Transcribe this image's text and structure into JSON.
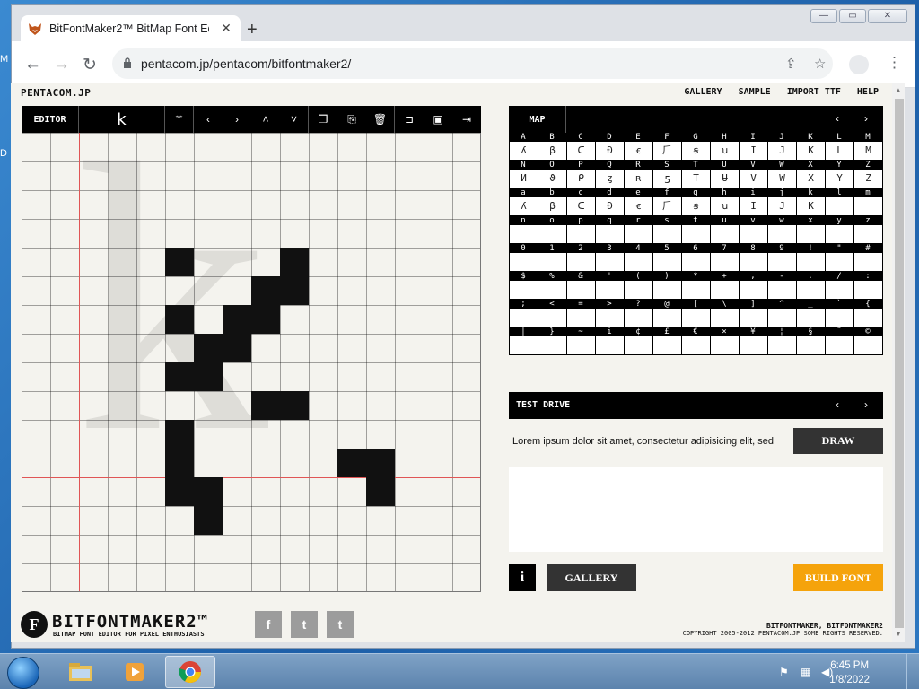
{
  "desktop": {
    "edge_labels": [
      "M",
      "D"
    ]
  },
  "browser": {
    "tab_title": "BitFontMaker2™ BitMap Font Edi",
    "url": "pentacom.jp/pentacom/bitfontmaker2/"
  },
  "page": {
    "brand": "PENTACOM.JP",
    "nav": [
      "GALLERY",
      "SAMPLE",
      "IMPORT TTF",
      "HELP"
    ],
    "editor": {
      "label": "EDITOR",
      "current_char": "k",
      "tools": [
        "magic-wand-icon",
        "arrow-left-icon",
        "arrow-right-icon",
        "arrow-up-icon",
        "arrow-down-icon",
        "copy-icon",
        "paste-icon",
        "trash-icon",
        "open-icon",
        "save-icon",
        "export-icon"
      ]
    },
    "map": {
      "title": "MAP",
      "rows": [
        {
          "header": [
            "A",
            "B",
            "C",
            "D",
            "E",
            "F",
            "G",
            "H",
            "I",
            "J",
            "K",
            "L",
            "M"
          ],
          "glyphs": [
            "ʎ",
            "β",
            "ᑕ",
            "Ð",
            "ꞓ",
            "⺁",
            "ꞩ",
            "ꭒ",
            "I",
            "J",
            "K",
            "L",
            "M"
          ]
        },
        {
          "header": [
            "N",
            "O",
            "P",
            "Q",
            "R",
            "S",
            "T",
            "U",
            "V",
            "W",
            "X",
            "Y",
            "Z"
          ],
          "glyphs": [
            "И",
            "ϑ",
            "ᑭ",
            "ȥ",
            "ʀ",
            "ƽ",
            "T",
            "Ʉ",
            "V",
            "W",
            "X",
            "Y",
            "Z"
          ]
        },
        {
          "header": [
            "a",
            "b",
            "c",
            "d",
            "e",
            "f",
            "g",
            "h",
            "i",
            "j",
            "k",
            "l",
            "m"
          ],
          "glyphs": [
            "ʎ",
            "β",
            "ᑕ",
            "Ð",
            "ꞓ",
            "⺁",
            "ꞩ",
            "ꭒ",
            "I",
            "J",
            "K",
            "",
            ""
          ]
        },
        {
          "header": [
            "n",
            "o",
            "p",
            "q",
            "r",
            "s",
            "t",
            "u",
            "v",
            "w",
            "x",
            "y",
            "z"
          ],
          "glyphs": [
            "",
            "",
            "",
            "",
            "",
            "",
            "",
            "",
            "",
            "",
            "",
            "",
            ""
          ]
        },
        {
          "header": [
            "0",
            "1",
            "2",
            "3",
            "4",
            "5",
            "6",
            "7",
            "8",
            "9",
            "!",
            "\"",
            "#"
          ],
          "glyphs": [
            "",
            "",
            "",
            "",
            "",
            "",
            "",
            "",
            "",
            "",
            "",
            "",
            ""
          ]
        },
        {
          "header": [
            "$",
            "%",
            "&",
            "'",
            "(",
            ")",
            "*",
            "+",
            ",",
            "-",
            ".",
            "/",
            ":"
          ],
          "glyphs": [
            "",
            "",
            "",
            "",
            "",
            "",
            "",
            "",
            "",
            "",
            "",
            "",
            ""
          ]
        },
        {
          "header": [
            ";",
            "<",
            "=",
            ">",
            "?",
            "@",
            "[",
            "\\",
            "]",
            "^",
            "_",
            "`",
            "{"
          ],
          "glyphs": [
            "",
            "",
            "",
            "",
            "",
            "",
            "",
            "",
            "",
            "",
            "",
            "",
            ""
          ]
        },
        {
          "header": [
            "|",
            "}",
            "~",
            "i",
            "¢",
            "£",
            "€",
            "×",
            "¥",
            "¦",
            "§",
            "¨",
            "©"
          ],
          "glyphs": [
            "",
            "",
            "",
            "",
            "",
            "",
            "",
            "",
            "",
            "",
            "",
            "",
            ""
          ]
        }
      ]
    },
    "test_drive": {
      "title": "TEST DRIVE",
      "sample_text": "Lorem ipsum dolor sit amet, consectetur adipisicing elit, sed",
      "draw_label": "DRAW"
    },
    "buttons": {
      "info": "i",
      "gallery": "GALLERY",
      "build": "BUILD FONT"
    },
    "footer": {
      "logo_letter": "F",
      "logo_name": "BITFONTMAKER2™",
      "tagline": "BITMAP FONT EDITOR FOR PIXEL ENTHUSIASTS",
      "social": [
        "f",
        "t",
        "t"
      ],
      "copyright_1": "BITFONTMAKER, BITFONTMAKER2",
      "copyright_2": "COPYRIGHT 2005-2012 PENTACOM.JP SOME RIGHTS RESERVED."
    }
  },
  "taskbar": {
    "time": "6:45 PM",
    "date": "1/8/2022"
  },
  "colors": {
    "accent": "#f5a30b",
    "guide": "#e05555",
    "ink": "#111111"
  }
}
